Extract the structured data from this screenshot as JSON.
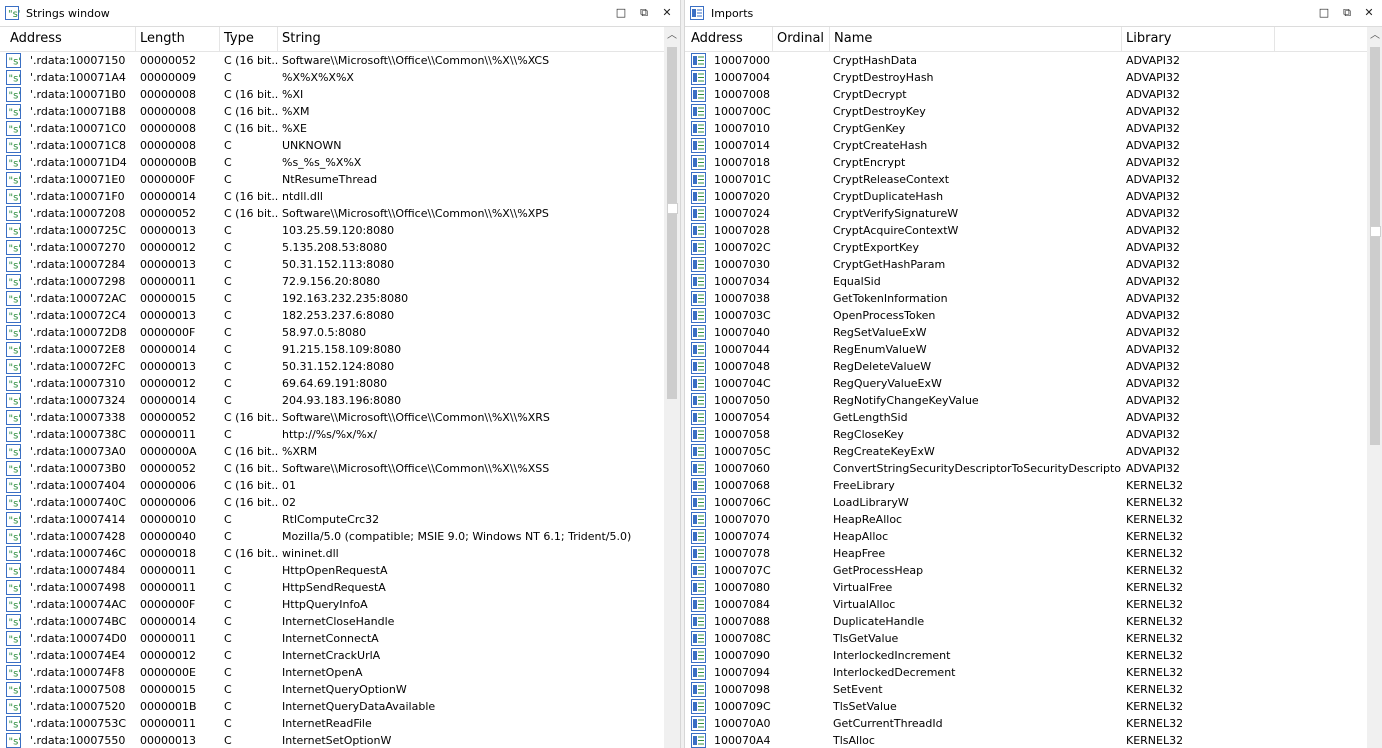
{
  "strings_window": {
    "title": "Strings window",
    "columns": [
      "Address",
      "Length",
      "Type",
      "String"
    ],
    "rows": [
      [
        "'.rdata:10007150",
        "00000052",
        "C (16 bit...",
        "Software\\\\Microsoft\\\\Office\\\\Common\\\\%X\\\\%XCS"
      ],
      [
        "'.rdata:100071A4",
        "00000009",
        "C",
        "%X%X%X%X"
      ],
      [
        "'.rdata:100071B0",
        "00000008",
        "C (16 bit...",
        "%XI"
      ],
      [
        "'.rdata:100071B8",
        "00000008",
        "C (16 bit...",
        "%XM"
      ],
      [
        "'.rdata:100071C0",
        "00000008",
        "C (16 bit...",
        "%XE"
      ],
      [
        "'.rdata:100071C8",
        "00000008",
        "C",
        "UNKNOWN"
      ],
      [
        "'.rdata:100071D4",
        "0000000B",
        "C",
        "%s_%s_%X%X"
      ],
      [
        "'.rdata:100071E0",
        "0000000F",
        "C",
        "NtResumeThread"
      ],
      [
        "'.rdata:100071F0",
        "00000014",
        "C (16 bit...",
        "ntdll.dll"
      ],
      [
        "'.rdata:10007208",
        "00000052",
        "C (16 bit...",
        "Software\\\\Microsoft\\\\Office\\\\Common\\\\%X\\\\%XPS"
      ],
      [
        "'.rdata:1000725C",
        "00000013",
        "C",
        "103.25.59.120:8080"
      ],
      [
        "'.rdata:10007270",
        "00000012",
        "C",
        "5.135.208.53:8080"
      ],
      [
        "'.rdata:10007284",
        "00000013",
        "C",
        "50.31.152.113:8080"
      ],
      [
        "'.rdata:10007298",
        "00000011",
        "C",
        "72.9.156.20:8080"
      ],
      [
        "'.rdata:100072AC",
        "00000015",
        "C",
        "192.163.232.235:8080"
      ],
      [
        "'.rdata:100072C4",
        "00000013",
        "C",
        "182.253.237.6:8080"
      ],
      [
        "'.rdata:100072D8",
        "0000000F",
        "C",
        "58.97.0.5:8080"
      ],
      [
        "'.rdata:100072E8",
        "00000014",
        "C",
        "91.215.158.109:8080"
      ],
      [
        "'.rdata:100072FC",
        "00000013",
        "C",
        "50.31.152.124:8080"
      ],
      [
        "'.rdata:10007310",
        "00000012",
        "C",
        "69.64.69.191:8080"
      ],
      [
        "'.rdata:10007324",
        "00000014",
        "C",
        "204.93.183.196:8080"
      ],
      [
        "'.rdata:10007338",
        "00000052",
        "C (16 bit...",
        "Software\\\\Microsoft\\\\Office\\\\Common\\\\%X\\\\%XRS"
      ],
      [
        "'.rdata:1000738C",
        "00000011",
        "C",
        "http://%s/%x/%x/"
      ],
      [
        "'.rdata:100073A0",
        "0000000A",
        "C (16 bit...",
        "%XRM"
      ],
      [
        "'.rdata:100073B0",
        "00000052",
        "C (16 bit...",
        "Software\\\\Microsoft\\\\Office\\\\Common\\\\%X\\\\%XSS"
      ],
      [
        "'.rdata:10007404",
        "00000006",
        "C (16 bit...",
        "01"
      ],
      [
        "'.rdata:1000740C",
        "00000006",
        "C (16 bit...",
        "02"
      ],
      [
        "'.rdata:10007414",
        "00000010",
        "C",
        "RtlComputeCrc32"
      ],
      [
        "'.rdata:10007428",
        "00000040",
        "C",
        "Mozilla/5.0 (compatible; MSIE 9.0; Windows NT 6.1; Trident/5.0)"
      ],
      [
        "'.rdata:1000746C",
        "00000018",
        "C (16 bit...",
        "wininet.dll"
      ],
      [
        "'.rdata:10007484",
        "00000011",
        "C",
        "HttpOpenRequestA"
      ],
      [
        "'.rdata:10007498",
        "00000011",
        "C",
        "HttpSendRequestA"
      ],
      [
        "'.rdata:100074AC",
        "0000000F",
        "C",
        "HttpQueryInfoA"
      ],
      [
        "'.rdata:100074BC",
        "00000014",
        "C",
        "InternetCloseHandle"
      ],
      [
        "'.rdata:100074D0",
        "00000011",
        "C",
        "InternetConnectA"
      ],
      [
        "'.rdata:100074E4",
        "00000012",
        "C",
        "InternetCrackUrlA"
      ],
      [
        "'.rdata:100074F8",
        "0000000E",
        "C",
        "InternetOpenA"
      ],
      [
        "'.rdata:10007508",
        "00000015",
        "C",
        "InternetQueryOptionW"
      ],
      [
        "'.rdata:10007520",
        "0000001B",
        "C",
        "InternetQueryDataAvailable"
      ],
      [
        "'.rdata:1000753C",
        "00000011",
        "C",
        "InternetReadFile"
      ],
      [
        "'.rdata:10007550",
        "00000013",
        "C",
        "InternetSetOptionW"
      ]
    ]
  },
  "imports_window": {
    "title": "Imports",
    "columns": [
      "Address",
      "Ordinal",
      "Name",
      "Library"
    ],
    "rows": [
      [
        "10007000",
        "",
        "CryptHashData",
        "ADVAPI32"
      ],
      [
        "10007004",
        "",
        "CryptDestroyHash",
        "ADVAPI32"
      ],
      [
        "10007008",
        "",
        "CryptDecrypt",
        "ADVAPI32"
      ],
      [
        "1000700C",
        "",
        "CryptDestroyKey",
        "ADVAPI32"
      ],
      [
        "10007010",
        "",
        "CryptGenKey",
        "ADVAPI32"
      ],
      [
        "10007014",
        "",
        "CryptCreateHash",
        "ADVAPI32"
      ],
      [
        "10007018",
        "",
        "CryptEncrypt",
        "ADVAPI32"
      ],
      [
        "1000701C",
        "",
        "CryptReleaseContext",
        "ADVAPI32"
      ],
      [
        "10007020",
        "",
        "CryptDuplicateHash",
        "ADVAPI32"
      ],
      [
        "10007024",
        "",
        "CryptVerifySignatureW",
        "ADVAPI32"
      ],
      [
        "10007028",
        "",
        "CryptAcquireContextW",
        "ADVAPI32"
      ],
      [
        "1000702C",
        "",
        "CryptExportKey",
        "ADVAPI32"
      ],
      [
        "10007030",
        "",
        "CryptGetHashParam",
        "ADVAPI32"
      ],
      [
        "10007034",
        "",
        "EqualSid",
        "ADVAPI32"
      ],
      [
        "10007038",
        "",
        "GetTokenInformation",
        "ADVAPI32"
      ],
      [
        "1000703C",
        "",
        "OpenProcessToken",
        "ADVAPI32"
      ],
      [
        "10007040",
        "",
        "RegSetValueExW",
        "ADVAPI32"
      ],
      [
        "10007044",
        "",
        "RegEnumValueW",
        "ADVAPI32"
      ],
      [
        "10007048",
        "",
        "RegDeleteValueW",
        "ADVAPI32"
      ],
      [
        "1000704C",
        "",
        "RegQueryValueExW",
        "ADVAPI32"
      ],
      [
        "10007050",
        "",
        "RegNotifyChangeKeyValue",
        "ADVAPI32"
      ],
      [
        "10007054",
        "",
        "GetLengthSid",
        "ADVAPI32"
      ],
      [
        "10007058",
        "",
        "RegCloseKey",
        "ADVAPI32"
      ],
      [
        "1000705C",
        "",
        "RegCreateKeyExW",
        "ADVAPI32"
      ],
      [
        "10007060",
        "",
        "ConvertStringSecurityDescriptorToSecurityDescriptorW",
        "ADVAPI32"
      ],
      [
        "10007068",
        "",
        "FreeLibrary",
        "KERNEL32"
      ],
      [
        "1000706C",
        "",
        "LoadLibraryW",
        "KERNEL32"
      ],
      [
        "10007070",
        "",
        "HeapReAlloc",
        "KERNEL32"
      ],
      [
        "10007074",
        "",
        "HeapAlloc",
        "KERNEL32"
      ],
      [
        "10007078",
        "",
        "HeapFree",
        "KERNEL32"
      ],
      [
        "1000707C",
        "",
        "GetProcessHeap",
        "KERNEL32"
      ],
      [
        "10007080",
        "",
        "VirtualFree",
        "KERNEL32"
      ],
      [
        "10007084",
        "",
        "VirtualAlloc",
        "KERNEL32"
      ],
      [
        "10007088",
        "",
        "DuplicateHandle",
        "KERNEL32"
      ],
      [
        "1000708C",
        "",
        "TlsGetValue",
        "KERNEL32"
      ],
      [
        "10007090",
        "",
        "InterlockedIncrement",
        "KERNEL32"
      ],
      [
        "10007094",
        "",
        "InterlockedDecrement",
        "KERNEL32"
      ],
      [
        "10007098",
        "",
        "SetEvent",
        "KERNEL32"
      ],
      [
        "1000709C",
        "",
        "TlsSetValue",
        "KERNEL32"
      ],
      [
        "100070A0",
        "",
        "GetCurrentThreadId",
        "KERNEL32"
      ],
      [
        "100070A4",
        "",
        "TlsAlloc",
        "KERNEL32"
      ]
    ]
  },
  "icons": {
    "string_row": "string-s-icon",
    "import_row": "import-table-icon",
    "strings_title": "strings-window-icon",
    "imports_title": "imports-window-icon"
  },
  "window_buttons": {
    "restore": "□",
    "float": "⧉",
    "close": "✕"
  },
  "colors": {
    "icon_blue": "#3a6fc4",
    "icon_green": "#2f8f3f",
    "row_bg": "#ffffff",
    "pane_bg": "#f0f0f0"
  }
}
